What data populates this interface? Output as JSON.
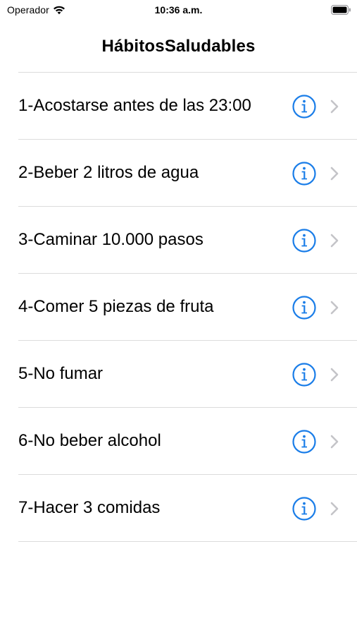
{
  "status_bar": {
    "carrier": "Operador",
    "time": "10:36 a.m."
  },
  "nav": {
    "title": "HábitosSaludables"
  },
  "colors": {
    "accent": "#1a7de8",
    "separator": "#dcdcdc",
    "chevron": "#c4c4c8"
  },
  "icons": {
    "detail": "info-icon",
    "disclosure": "chevron-right-icon"
  },
  "habits": [
    {
      "label": "1-Acostarse antes de las 23:00"
    },
    {
      "label": "2-Beber 2 litros de agua"
    },
    {
      "label": "3-Caminar 10.000 pasos"
    },
    {
      "label": "4-Comer 5 piezas de fruta"
    },
    {
      "label": "5-No fumar"
    },
    {
      "label": "6-No beber alcohol"
    },
    {
      "label": "7-Hacer 3 comidas"
    }
  ]
}
